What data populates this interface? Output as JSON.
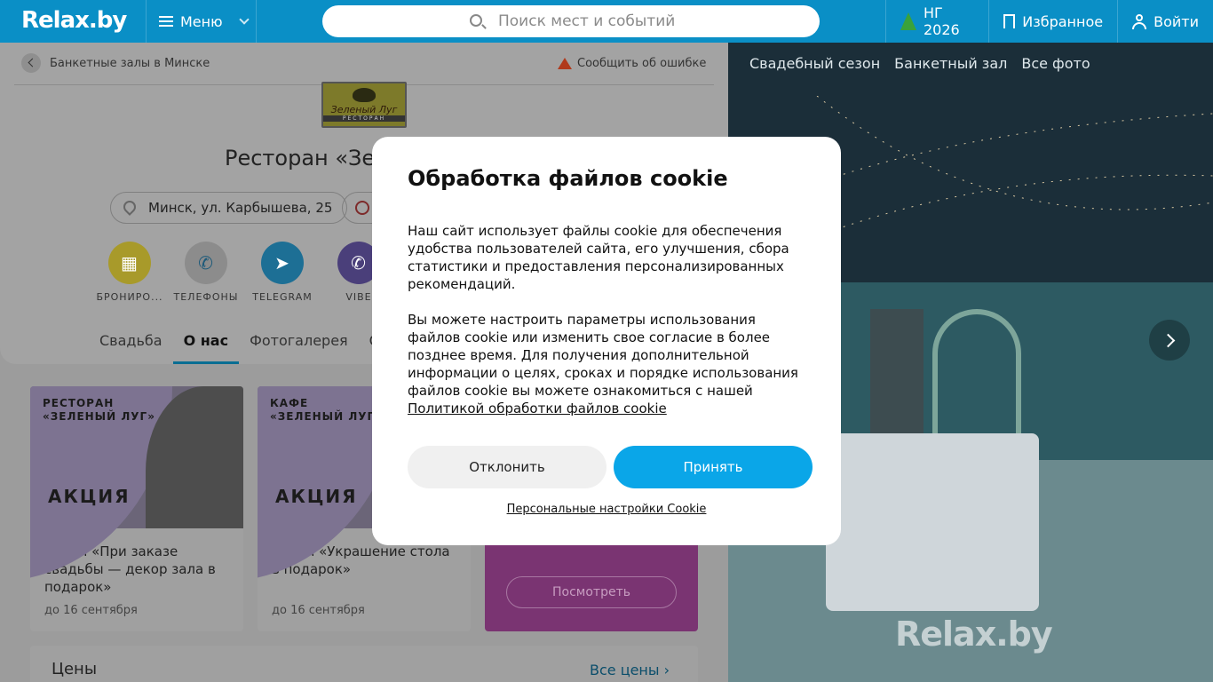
{
  "header": {
    "logo": "Relax.by",
    "menu_label": "Меню",
    "search_placeholder": "Поиск мест и событий",
    "ny_label": "НГ 2026",
    "favorites_label": "Избранное",
    "login_label": "Войти"
  },
  "page": {
    "breadcrumb": "Банкетные залы в Минске",
    "report_error": "Сообщить об ошибке",
    "logo_text": "Зеленый Луг",
    "logo_sub": "РЕСТОРАН",
    "title": "Ресторан «Зе",
    "address": "Минск, ул. Карбышева, 25",
    "actions": [
      {
        "label": "БРОНИРО...",
        "icon": "calendar-icon",
        "color": "#a89a2a"
      },
      {
        "label": "ТЕЛЕФОНЫ",
        "icon": "phone-icon",
        "color": "#8c8c8c"
      },
      {
        "label": "TELEGRAM",
        "icon": "telegram-icon",
        "color": "#1d6f95"
      },
      {
        "label": "VIBE",
        "icon": "viber-icon",
        "color": "#4a3f7a"
      }
    ],
    "tabs": [
      {
        "label": "Свадьба",
        "active": false
      },
      {
        "label": "О нас",
        "active": true
      },
      {
        "label": "Фотогалерея",
        "active": false
      },
      {
        "label": "Ск",
        "active": false
      }
    ],
    "promos": [
      {
        "brand_line1": "РЕСТОРАН",
        "brand_line2": "«ЗЕЛЕНЫЙ ЛУГ»",
        "badge": "АКЦИЯ",
        "text": "Акция «При заказе свадьбы — декор зала в подарок»",
        "date": "до 16 сентября"
      },
      {
        "brand_line1": "КАФЕ",
        "brand_line2": "«ЗЕЛЕНЫЙ ЛУГ»",
        "badge": "АКЦИЯ",
        "text": "Акция «Украшение стола в подарок»",
        "date": "до 16 сентября"
      }
    ],
    "promo3_button": "Посмотреть",
    "prices_title": "Цены",
    "all_prices": "Все цены"
  },
  "photo": {
    "tabs": [
      "Свадебный сезон",
      "Банкетный зал",
      "Все фото"
    ],
    "watermark": "Relax.by"
  },
  "cookie_modal": {
    "title": "Обработка файлов cookie",
    "para1": "Наш сайт использует файлы cookie для обеспечения удобства пользователей сайта, его улучшения, сбора статистики и предоставления персонализированных рекомендаций.",
    "para2": "Вы можете настроить параметры использования файлов cookie или изменить свое согласие в более позднее время. Для получения дополнительной информации о целях, сроках и порядке использования файлов cookie вы можете ознакомиться с нашей",
    "policy_link": "Политикой обработки файлов cookie",
    "decline": "Отклонить",
    "accept": "Принять",
    "personal_settings": "Персональные настройки Cookie"
  },
  "colors": {
    "header_bg": "#0a8fc6",
    "accept_btn": "#0aa6e8",
    "promo_accent": "#7a3472"
  }
}
